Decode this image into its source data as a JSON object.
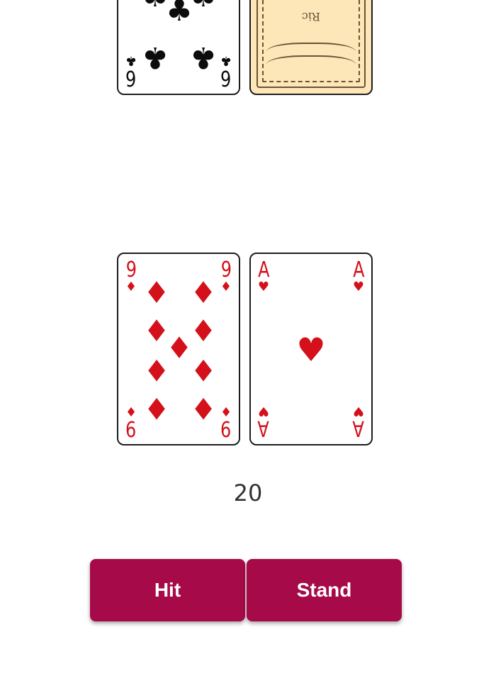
{
  "colors": {
    "button_bg": "#a60a48",
    "button_text": "#ffffff",
    "card_red": "#d4111b",
    "card_black": "#0c0c0c",
    "card_back": "#fde7b8",
    "score_text": "#333333"
  },
  "dealer": {
    "cards": [
      {
        "rank": "6",
        "suit": "clubs",
        "suit_glyph": "♣",
        "face_up": true
      },
      {
        "face_up": false,
        "back_text": "Ric"
      }
    ]
  },
  "player": {
    "cards": [
      {
        "rank": "9",
        "suit": "diamonds",
        "suit_glyph": "♦",
        "face_up": true
      },
      {
        "rank": "A",
        "suit": "hearts",
        "suit_glyph": "♥",
        "face_up": true
      }
    ],
    "score": "20"
  },
  "controls": {
    "hit_label": "Hit",
    "stand_label": "Stand"
  }
}
